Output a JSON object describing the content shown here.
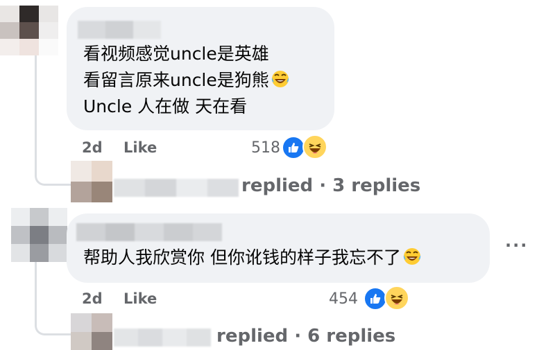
{
  "comments": [
    {
      "lines": [
        "看视频感觉uncle是英雄",
        "看留言原来uncle是狗熊",
        "Uncle 人在做 天在看"
      ],
      "emoji_after_line": 2,
      "emoji": "laughing-tears",
      "time": "2d",
      "like_label": "Like",
      "reaction_count": "518",
      "reactions": [
        "like",
        "haha"
      ],
      "replies_text": "replied · 3 replies"
    },
    {
      "lines": [
        "帮助人我欣赏你 但你讹钱的样子我忘不了"
      ],
      "emoji_after_line": 1,
      "emoji": "laughing-tears",
      "time": "2d",
      "like_label": "Like",
      "reaction_count": "454",
      "reactions": [
        "like",
        "haha"
      ],
      "replies_text": "replied · 6 replies",
      "more_options": "···"
    }
  ],
  "colors": {
    "bubble": "#f0f2f5",
    "meta_text": "#65676b",
    "like_blue": "#1877f2",
    "haha_yellow": "#ffd55c"
  }
}
